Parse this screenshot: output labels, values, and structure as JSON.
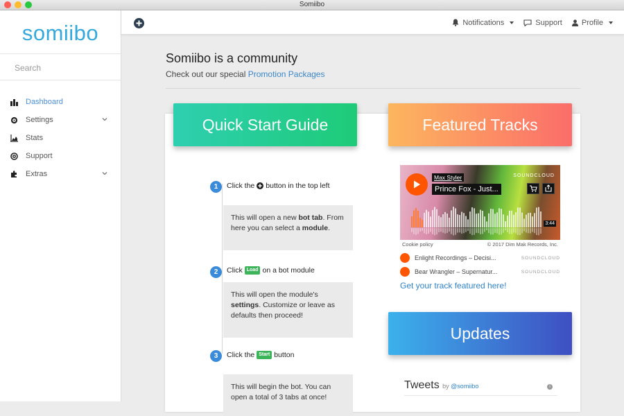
{
  "window": {
    "title": "Somiibo"
  },
  "sidebar": {
    "logo": "somiibo",
    "search_placeholder": "Search",
    "items": [
      {
        "label": "Dashboard",
        "icon": "dashboard-icon"
      },
      {
        "label": "Settings",
        "icon": "gear-icon"
      },
      {
        "label": "Stats",
        "icon": "chart-icon"
      },
      {
        "label": "Support",
        "icon": "lifebuoy-icon"
      },
      {
        "label": "Extras",
        "icon": "puzzle-icon"
      }
    ]
  },
  "topbar": {
    "notifications": "Notifications",
    "support": "Support",
    "profile": "Profile"
  },
  "hero": {
    "title": "Somiibo is a community",
    "subtitle_prefix": "Check out our special ",
    "subtitle_link": "Promotion Packages"
  },
  "quickstart": {
    "title": "Quick Start Guide",
    "steps": [
      {
        "num": "1",
        "prefix": "Click the",
        "suffix": "button in the top left",
        "body_1": "This will open a new ",
        "body_b1": "bot tab",
        "body_2": ". From here you can select a ",
        "body_b2": "module",
        "body_3": "."
      },
      {
        "num": "2",
        "prefix": "Click",
        "tag": "Load",
        "suffix": "on a bot module",
        "body_1": "This will open the module's ",
        "body_b1": "settings",
        "body_2": ". Customize or leave as defaults then proceed!"
      },
      {
        "num": "3",
        "prefix": "Click the",
        "tag": "Start",
        "suffix": "button",
        "body_1": "This will begin the bot. You can open a total of 3 tabs at once!"
      }
    ]
  },
  "featured": {
    "title": "Featured Tracks",
    "player": {
      "artist": "Max Styler",
      "track": "Prince Fox - Just...",
      "brand": "SOUNDCLOUD",
      "duration": "3:44",
      "cookie": "Cookie policy",
      "copyright": "© 2017 Dim Mak Records, Inc."
    },
    "list": [
      {
        "title": "Enlight Recordings – Decisi...",
        "brand": "SOUNDCLOUD"
      },
      {
        "title": "Bear Wrangler – Supernatur...",
        "brand": "SOUNDCLOUD"
      }
    ],
    "link": "Get your track featured here!"
  },
  "updates": {
    "title": "Updates",
    "tweets_label": "Tweets",
    "tweets_by": "by",
    "tweets_handle": "@somiibo"
  },
  "colors": {
    "accent": "#35a9dc",
    "soundcloud": "#ff5500",
    "tag_green": "#3cb45a"
  }
}
